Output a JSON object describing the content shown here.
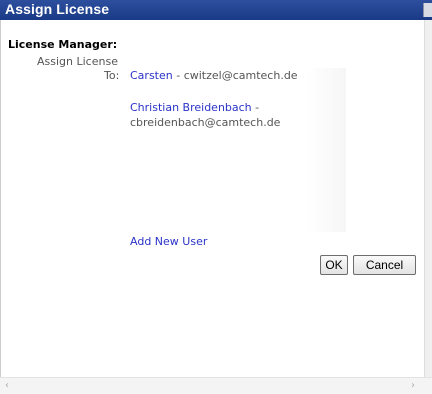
{
  "window": {
    "title": "Assign License"
  },
  "content": {
    "section_title": "License Manager:",
    "subtitle": "Assign License",
    "to_label": "To:"
  },
  "recipients": [
    {
      "name": "Carsten",
      "separator": " - ",
      "email": "cwitzel@camtech.de"
    },
    {
      "name": "Christian Breidenbach",
      "separator": " -",
      "email": "cbreidenbach@camtech.de"
    }
  ],
  "actions": {
    "add_user": "Add New User",
    "ok": "OK",
    "cancel": "Cancel"
  },
  "icons": {
    "close": "close-icon",
    "scroll_left": "chevron-left-icon",
    "scroll_right": "chevron-right-icon"
  },
  "colors": {
    "titlebar": "#1f3f8f",
    "link": "#2a33c7"
  }
}
